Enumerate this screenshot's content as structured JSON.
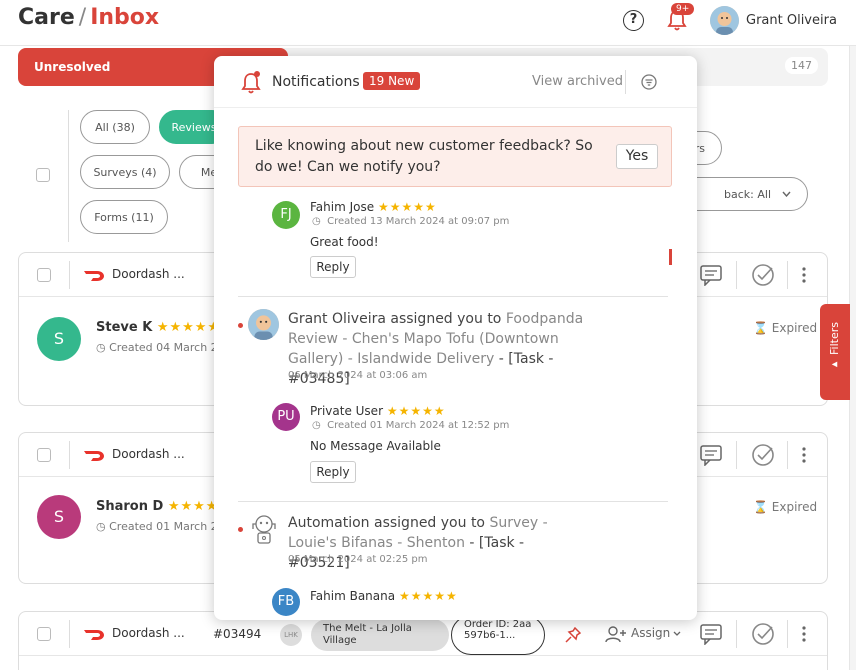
{
  "header": {
    "title_left": "Care",
    "title_sep": "/",
    "title_right": "Inbox",
    "help_label": "?",
    "notif_badge": "9+",
    "user_name": "Grant Oliveira"
  },
  "tabs": {
    "unresolved_label": "Unresolved",
    "count": "147"
  },
  "filter_pills": [
    {
      "label": "All (38)"
    },
    {
      "label": "Reviews"
    },
    {
      "label": "Surveys (4)"
    },
    {
      "label": "Me"
    },
    {
      "label": "Forms (11)"
    },
    {
      "label": "rs"
    },
    {
      "label": "back: All"
    }
  ],
  "cards": [
    {
      "platform": "Doordash ...",
      "name": "Steve K",
      "created": "Created 04 March 20",
      "avatar_initial": "S",
      "status": "Expired"
    },
    {
      "platform": "Doordash ...",
      "name": "Sharon D",
      "created": "Created 01 March 20",
      "avatar_initial": "S",
      "status": "Expired"
    },
    {
      "platform": "Doordash ...",
      "ticket": "#03494",
      "loc_initials": "LHK",
      "location": "The Melt - La Jolla Village",
      "order": "Order ID: 2aa597b6-1...",
      "assign_label": "Assign"
    }
  ],
  "filters_label": "Filters",
  "notifications": {
    "title": "Notifications",
    "new_badge": "19 New",
    "view_archived": "View archived",
    "prompt_text": "Like knowing about new customer feedback? So do we! Can we notify you?",
    "yes_label": "Yes",
    "reply_label": "Reply",
    "items": [
      {
        "type": "review",
        "initials": "FJ",
        "name": "Fahim Jose",
        "stars": "★★★★★",
        "created": "Created 13 March 2024 at 09:07 pm",
        "text": "Great food!"
      },
      {
        "type": "assign",
        "actor": "Grant Oliveira",
        "verb": "assigned you to",
        "target": "Foodpanda Review - Chen's Mapo Tofu (Downtown Gallery) - Islandwide Delivery",
        "task": " - [Task - #03485]",
        "date": "06 March 2024 at 03:06 am"
      },
      {
        "type": "review",
        "initials": "PU",
        "name": "Private User",
        "stars": "★★★★★",
        "created": "Created 01 March 2024 at 12:52 pm",
        "text": "No Message Available"
      },
      {
        "type": "assign",
        "actor": "Automation",
        "verb": "assigned you to",
        "target": "Survey - Louie's Bifanas - Shenton",
        "task": " - [Task - #03521]",
        "date": "05 March 2024 at 02:25 pm"
      },
      {
        "type": "review",
        "initials": "FB",
        "name": "Fahim Banana",
        "stars": "★★★★★"
      }
    ]
  },
  "colors": {
    "brand_red": "#d9443a",
    "active_green": "#34b88d",
    "star": "#f5b400"
  }
}
